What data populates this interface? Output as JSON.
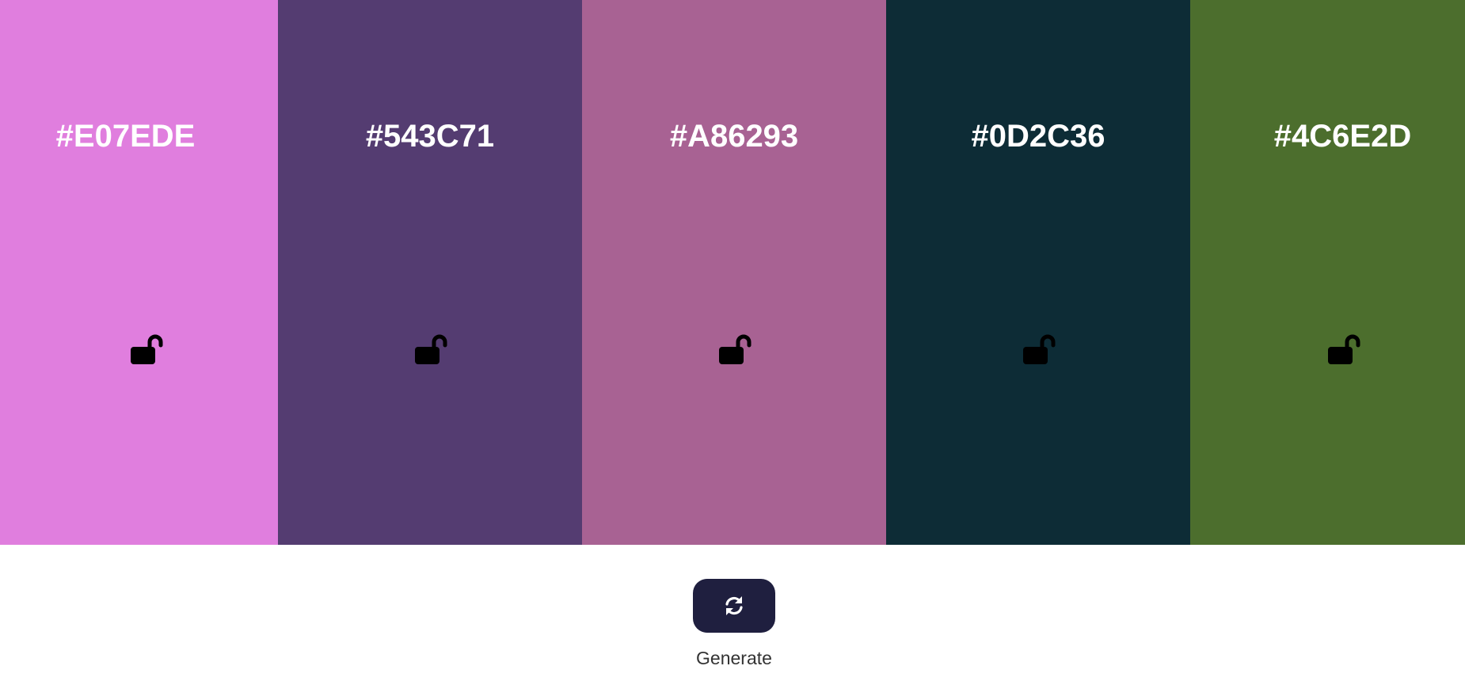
{
  "palette": {
    "colors": [
      {
        "hex": "#E07EDE",
        "locked": false
      },
      {
        "hex": "#543C71",
        "locked": false
      },
      {
        "hex": "#A86293",
        "locked": false
      },
      {
        "hex": "#0D2C36",
        "locked": false
      },
      {
        "hex": "#4C6E2D",
        "locked": false
      }
    ],
    "lock_icon": "unlocked-padlock-icon",
    "text_color": "#FFFFFF"
  },
  "generate": {
    "label": "Generate",
    "icon": "refresh-icon",
    "button_color": "#1F1F3F"
  }
}
